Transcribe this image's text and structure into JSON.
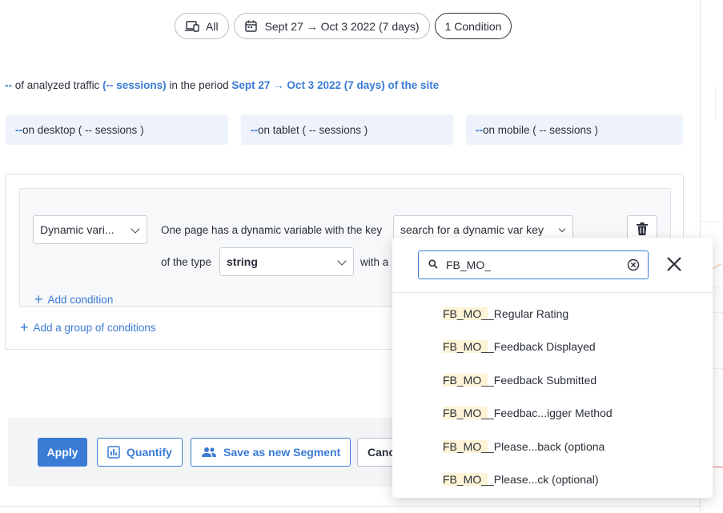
{
  "filters": {
    "device_label": "All",
    "date_label": "Sept 27 → Oct 3 2022 (7 days)",
    "condition_label": "1 Condition"
  },
  "summary": {
    "value": "--",
    "text1": " of analyzed traffic ",
    "sessions": "(-- sessions)",
    "text2": " in the period ",
    "period": "Sept 27 → Oct 3 2022 (7 days) of the site"
  },
  "devices": [
    {
      "value": "--",
      "label": " on desktop ( -- sessions )"
    },
    {
      "value": "--",
      "label": " on tablet ( -- sessions )"
    },
    {
      "value": "--",
      "label": " on mobile ( -- sessions )"
    }
  ],
  "condition": {
    "type_select": "Dynamic vari...",
    "text_prefix": "One page has a dynamic variable with the key",
    "key_select": "search for a dynamic var key",
    "type_label": "of the type",
    "value_type_select": "string",
    "with_label": "with a"
  },
  "links": {
    "add_condition": "Add condition",
    "add_group": "Add a group of conditions"
  },
  "actions": {
    "apply": "Apply",
    "quantify": "Quantify",
    "save_segment": "Save as new Segment",
    "cancel": "Canc"
  },
  "dropdown": {
    "search_value": "FB_MO_",
    "match": "FB_MO_",
    "options": [
      "_Regular Rating",
      "_Feedback Displayed",
      "_Feedback Submitted",
      "_Feedbac...igger Method",
      "_Please...back (optiona",
      "_Please...ck (optional)"
    ]
  },
  "colors": {
    "accent": "#3a7bd5",
    "highlight": "#fdf3d6",
    "device_bg": "#eef3fb"
  }
}
